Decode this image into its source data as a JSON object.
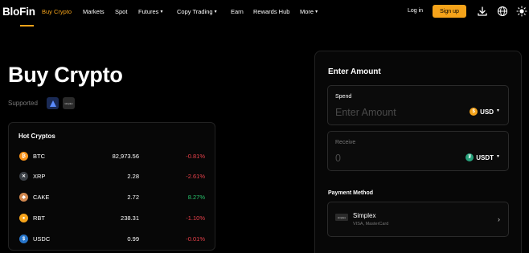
{
  "nav": {
    "logo": "BloFin",
    "items": [
      {
        "label": "Buy Crypto",
        "active": true
      },
      {
        "label": "Markets"
      },
      {
        "label": "Spot"
      },
      {
        "label": "Futures",
        "dropdown": true
      },
      {
        "label": "Copy Trading",
        "dropdown": true
      },
      {
        "label": "Earn"
      },
      {
        "label": "Rewards Hub"
      },
      {
        "label": "More",
        "dropdown": true
      }
    ],
    "login": "Log in",
    "signup": "Sign up",
    "icons": [
      "download-icon",
      "globe-icon",
      "theme-sun-icon"
    ]
  },
  "hero": {
    "title": "Buy Crypto",
    "supported": "Supported",
    "provider_logo_text": "simplex"
  },
  "hot": {
    "title": "Hot Cryptos",
    "rows": [
      {
        "symbol": "BTC",
        "price": "82,973.56",
        "change": "-0.81%",
        "trend": "neg",
        "icon_color": "#f7931a",
        "icon_glyph": "₿"
      },
      {
        "symbol": "XRP",
        "price": "2.28",
        "change": "-2.61%",
        "trend": "neg",
        "icon_color": "#23292f",
        "icon_glyph": "✕"
      },
      {
        "symbol": "CAKE",
        "price": "2.72",
        "change": "8.27%",
        "trend": "pos",
        "icon_color": "#d1884f",
        "icon_glyph": "◆"
      },
      {
        "symbol": "RBT",
        "price": "238.31",
        "change": "-1.10%",
        "trend": "neg",
        "icon_color": "#f5a31a",
        "icon_glyph": "●"
      },
      {
        "symbol": "USDC",
        "price": "0.99",
        "change": "-0.01%",
        "trend": "neg",
        "icon_color": "#2775ca",
        "icon_glyph": "$"
      }
    ]
  },
  "panel": {
    "title": "Enter Amount",
    "spend": {
      "label": "Spend",
      "placeholder": "Enter Amount",
      "currency": "USD",
      "icon_color": "#f5a31a",
      "icon_glyph": "$"
    },
    "receive": {
      "label": "Receive",
      "value": "0",
      "currency": "USDT",
      "icon_color": "#26a17b",
      "icon_glyph": "₮"
    },
    "payment_method_title": "Payment Method",
    "payment": {
      "name": "Simplex",
      "sub": "VISA, MasterCard",
      "logo_text": "simplex"
    }
  },
  "colors": {
    "accent": "#f5a31a",
    "negative": "#e6404a",
    "positive": "#27c26b"
  }
}
